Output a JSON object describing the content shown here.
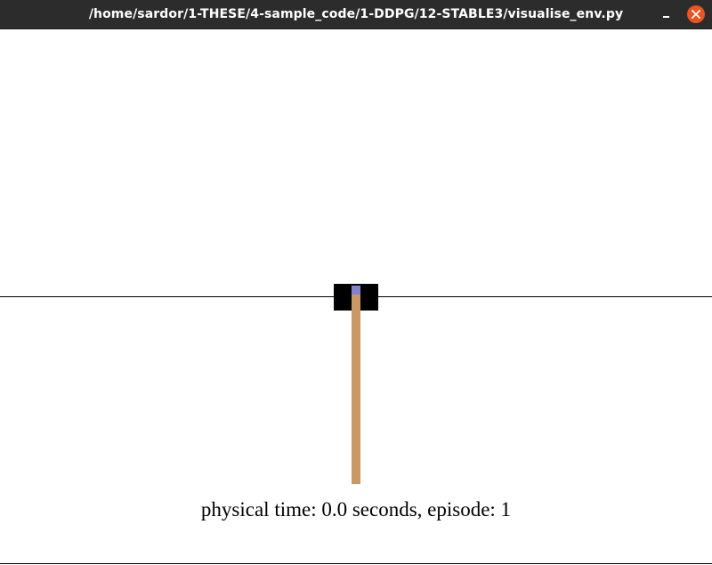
{
  "window": {
    "title": "/home/sardor/1-THESE/4-sample_code/1-DDPG/12-STABLE3/visualise_env.py",
    "minimize_icon": "minimize-icon",
    "close_icon": "close-icon",
    "close_color": "#e95420"
  },
  "scene": {
    "cart_color": "#000000",
    "pole_color": "#ca9865",
    "axle_color": "#8184cb",
    "status_text": "physical time: 0.0 seconds, episode: 1"
  }
}
